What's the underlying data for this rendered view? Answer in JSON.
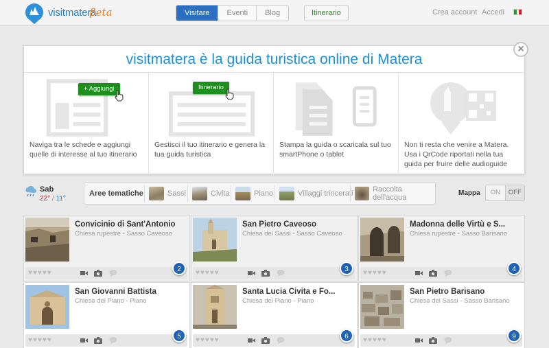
{
  "header": {
    "brand": "visitmatera",
    "beta": "βeta",
    "tabs": [
      {
        "label": "Visitare",
        "active": true
      },
      {
        "label": "Eventi",
        "active": false
      },
      {
        "label": "Blog",
        "active": false
      }
    ],
    "itinerary_button": "Itinerario",
    "create_account": "Crea account",
    "login": "Accedi"
  },
  "intro": {
    "title": "visitmatera è la guida turistica online di Matera",
    "steps": [
      {
        "text": "Naviga tra le schede e aggiungi quelle di interesse al tuo itinerario",
        "button": "+ Aggiungi"
      },
      {
        "text": "Gestisci il tuo itinerario e genera la tua guida turistica",
        "button": "Itinerario"
      },
      {
        "text": "Stampa la guida o scaricala sul tuo smartPhone o tablet"
      },
      {
        "text": "Non ti resta che venire a Matera. Usa i QrCode riportati nella tua guida per fruire delle audioguide"
      }
    ]
  },
  "weather": {
    "day": "Sab",
    "max": "22°",
    "sep": " / ",
    "min": "11°"
  },
  "themes": {
    "label": "Aree tematiche",
    "items": [
      "Sassi",
      "Civita",
      "Piano",
      "Villaggi trincerati",
      "Raccolta dell'acqua"
    ]
  },
  "map": {
    "label": "Mappa",
    "on": "ON",
    "off": "OFF",
    "state": "OFF"
  },
  "cards": [
    {
      "title": "Convicinio di Sant'Antonio",
      "subtitle": "Chiesa rupestre - Sasso Caveoso",
      "number": "2"
    },
    {
      "title": "San Pietro Caveoso",
      "subtitle": "Chiesa dei Sassi - Sasso Caveoso",
      "number": "3"
    },
    {
      "title": "Madonna delle Virtù e S...",
      "subtitle": "Chiesa rupestre - Sasso Barisano",
      "number": "4"
    },
    {
      "title": "San Giovanni Battista",
      "subtitle": "Chiesa del Piano - Piano",
      "number": "5"
    },
    {
      "title": "Santa Lucia Civita e Fo...",
      "subtitle": "Chiesa del Piano - Piano",
      "number": "6"
    },
    {
      "title": "San Pietro Barisano",
      "subtitle": "Chiesa dei Sassi - Sasso Barisano",
      "number": "9"
    }
  ],
  "colors": {
    "accent": "#1e8fd6",
    "nav_active": "#2b6fc0",
    "green": "#1d8f1d",
    "pin": "#1c63b7",
    "brand_orange": "#ef7b1b"
  },
  "icons": [
    "logo-pin-icon",
    "close-icon",
    "cloud-rain-icon",
    "camera-icon",
    "video-icon",
    "comment-icon",
    "heart-icon",
    "hand-cursor-icon",
    "qrcode-icon"
  ]
}
